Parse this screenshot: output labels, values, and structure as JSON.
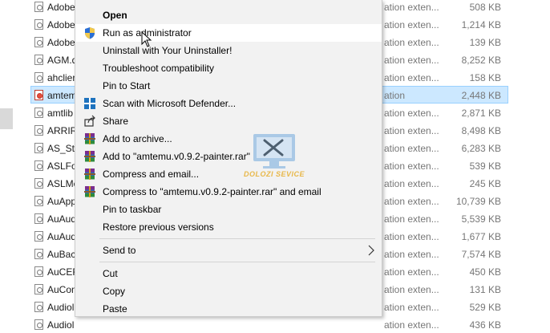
{
  "file_rows": [
    {
      "name": "Adobe",
      "type": "ation exten...",
      "size": "508 KB"
    },
    {
      "name": "Adobe",
      "type": "ation exten...",
      "size": "1,214 KB"
    },
    {
      "name": "Adobe",
      "type": "ation exten...",
      "size": "139 KB"
    },
    {
      "name": "AGM.d",
      "type": "ation exten...",
      "size": "8,252 KB"
    },
    {
      "name": "ahclier",
      "type": "ation exten...",
      "size": "158 KB"
    },
    {
      "name": "amtem",
      "type": "ation",
      "size": "2,448 KB",
      "selected": true,
      "app": true
    },
    {
      "name": "amtlib",
      "type": "ation exten...",
      "size": "2,871 KB"
    },
    {
      "name": "ARRIRA",
      "type": "ation exten...",
      "size": "8,498 KB"
    },
    {
      "name": "AS_Sto",
      "type": "ation exten...",
      "size": "6,283 KB"
    },
    {
      "name": "ASLFo",
      "type": "ation exten...",
      "size": "539 KB"
    },
    {
      "name": "ASLMe",
      "type": "ation exten...",
      "size": "245 KB"
    },
    {
      "name": "AuApp",
      "type": "ation exten...",
      "size": "10,739 KB"
    },
    {
      "name": "AuAud",
      "type": "ation exten...",
      "size": "5,539 KB"
    },
    {
      "name": "AuAud",
      "type": "ation exten...",
      "size": "1,677 KB"
    },
    {
      "name": "AuBac",
      "type": "ation exten...",
      "size": "7,574 KB"
    },
    {
      "name": "AuCEF",
      "type": "ation exten...",
      "size": "450 KB"
    },
    {
      "name": "AuCon",
      "type": "ation exten...",
      "size": "131 KB"
    },
    {
      "name": "Audiol",
      "type": "ation exten...",
      "size": "529 KB"
    },
    {
      "name": "Audiol",
      "type": "ation exten...",
      "size": "436 KB"
    }
  ],
  "context_menu": {
    "items": [
      {
        "label": "Open",
        "bold": true
      },
      {
        "label": "Run as administrator",
        "icon": "shield-icon",
        "hover": true
      },
      {
        "label": "Uninstall with Your Uninstaller!"
      },
      {
        "label": "Troubleshoot compatibility"
      },
      {
        "label": "Pin to Start"
      },
      {
        "label": "Scan with Microsoft Defender...",
        "icon": "defender-icon"
      },
      {
        "label": "Share",
        "icon": "share-icon"
      },
      {
        "label": "Add to archive...",
        "icon": "winrar-icon"
      },
      {
        "label": "Add to \"amtemu.v0.9.2-painter.rar\"",
        "icon": "winrar-icon"
      },
      {
        "label": "Compress and email...",
        "icon": "winrar-icon"
      },
      {
        "label": "Compress to \"amtemu.v0.9.2-painter.rar\" and email",
        "icon": "winrar-icon"
      },
      {
        "label": "Pin to taskbar"
      },
      {
        "label": "Restore previous versions"
      },
      {
        "separator": true
      },
      {
        "label": "Send to",
        "submenu": true
      },
      {
        "separator": true
      },
      {
        "label": "Cut"
      },
      {
        "label": "Copy"
      },
      {
        "label": "Paste"
      }
    ]
  },
  "watermark": {
    "text": "DOLOZI SEVICE",
    "icon": "tools-monitor-icon"
  },
  "colors": {
    "selection": "#cce8ff",
    "selection_border": "#99d1ff",
    "menu_bg": "#f2f2f2",
    "menu_hover": "#ffffff",
    "watermark": "#e8b84a"
  }
}
